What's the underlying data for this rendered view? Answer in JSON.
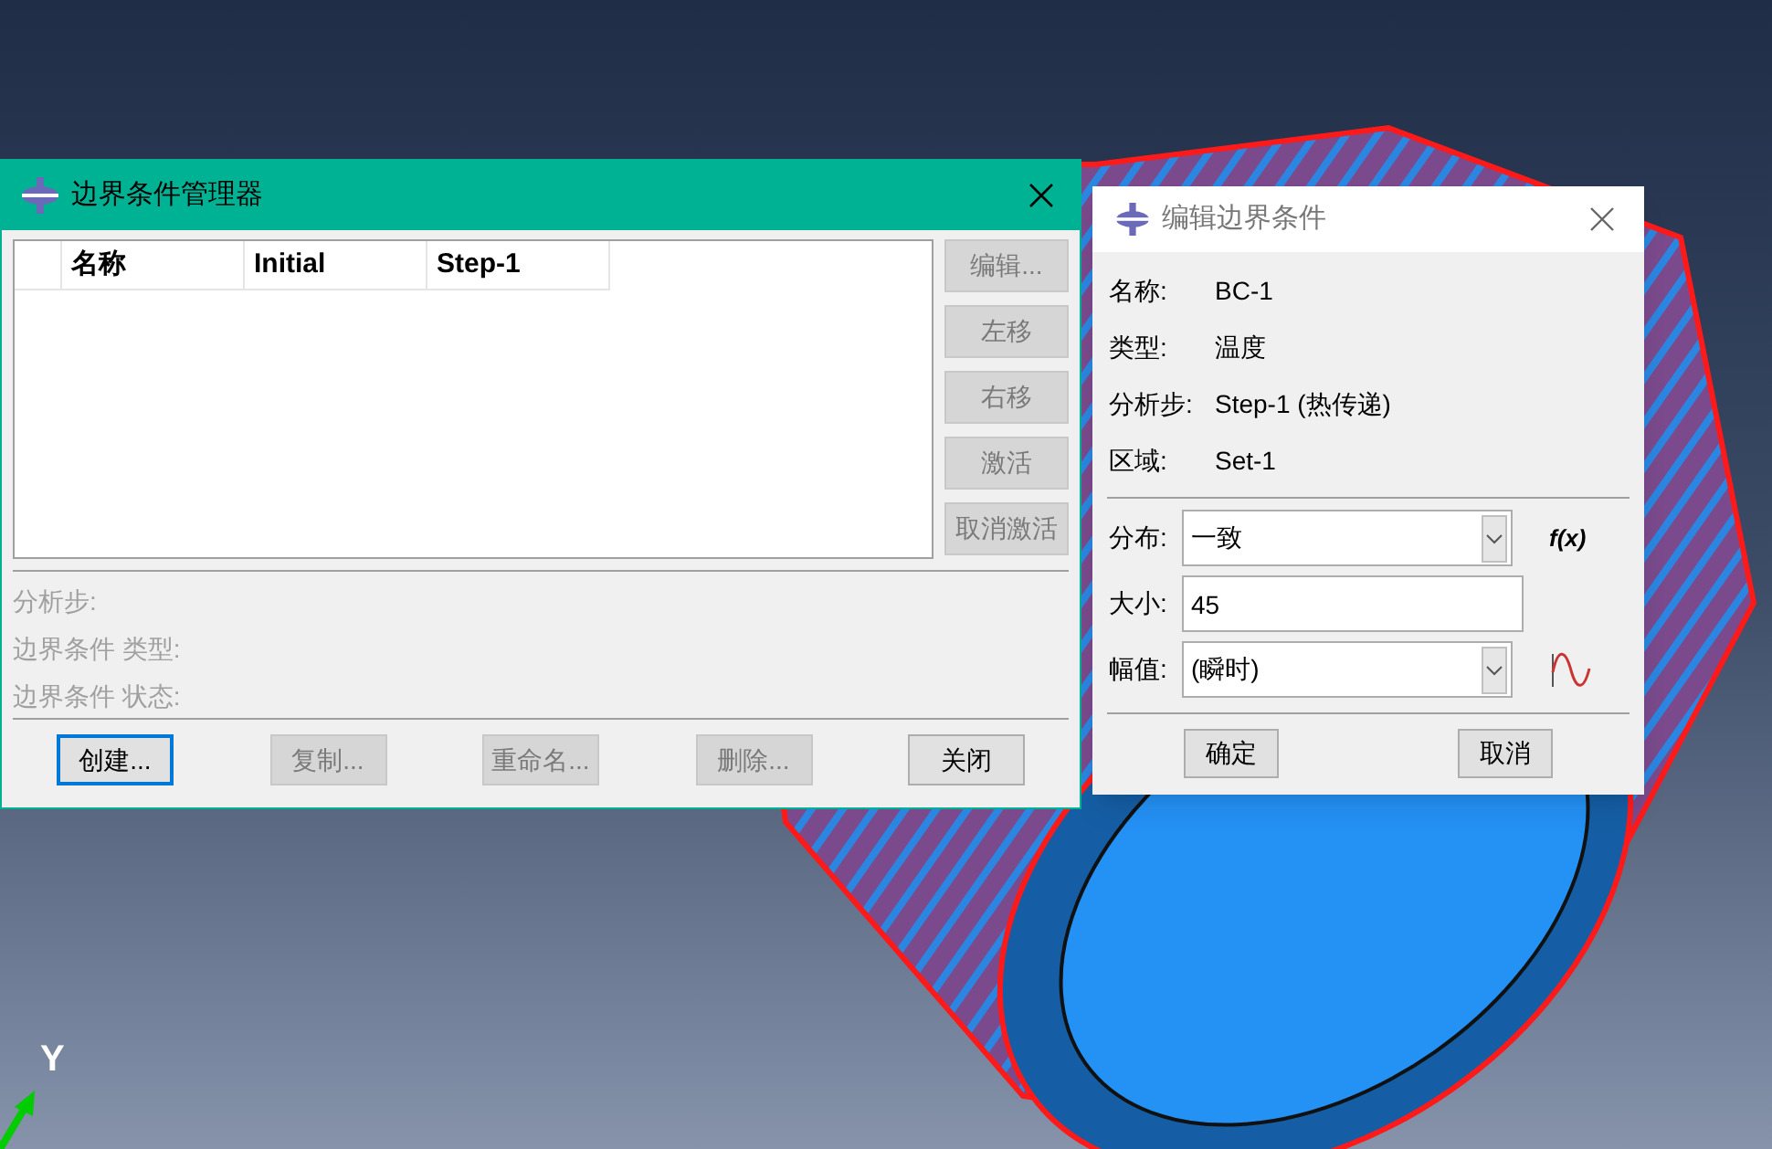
{
  "viewport": {
    "axis_label": "Y"
  },
  "manager": {
    "title": "边界条件管理器",
    "columns": [
      "名称",
      "Initial",
      "Step-1"
    ],
    "side_buttons": [
      {
        "label": "编辑...",
        "disabled": true
      },
      {
        "label": "左移",
        "disabled": true
      },
      {
        "label": "右移",
        "disabled": true
      },
      {
        "label": "激活",
        "disabled": true
      },
      {
        "label": "取消激活",
        "disabled": true
      }
    ],
    "info_labels": [
      "分析步:",
      "边界条件 类型:",
      "边界条件 状态:"
    ],
    "buttons": [
      {
        "label": "创建...",
        "disabled": false,
        "focused": true
      },
      {
        "label": "复制...",
        "disabled": true,
        "focused": false
      },
      {
        "label": "重命名...",
        "disabled": true,
        "focused": false
      },
      {
        "label": "删除...",
        "disabled": true,
        "focused": false
      },
      {
        "label": "关闭",
        "disabled": false,
        "focused": false
      }
    ]
  },
  "editor": {
    "title": "编辑边界条件",
    "fields": [
      {
        "label": "名称:",
        "value": "BC-1"
      },
      {
        "label": "类型:",
        "value": "温度"
      },
      {
        "label": "分析步:",
        "value": "Step-1 (热传递)"
      },
      {
        "label": "区域:",
        "value": "Set-1"
      }
    ],
    "inputs": [
      {
        "kind": "dropdown",
        "label": "分布:",
        "value": "一致",
        "extra": "f(x)"
      },
      {
        "kind": "text",
        "label": "大小:",
        "value": "45"
      },
      {
        "kind": "dropdown",
        "label": "幅值:",
        "value": "(瞬时)",
        "wave_icon": true
      }
    ],
    "buttons": [
      "确定",
      "取消"
    ]
  }
}
